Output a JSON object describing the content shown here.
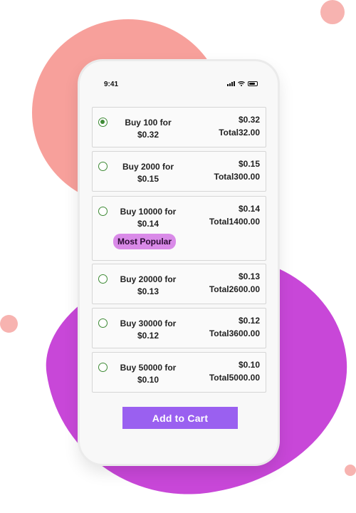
{
  "status_bar": {
    "time": "9:41"
  },
  "options": [
    {
      "line1": "Buy 100 for",
      "line2": "$0.32",
      "price": "$0.32",
      "total": "Total32.00",
      "selected": true
    },
    {
      "line1": "Buy 2000 for",
      "line2": "$0.15",
      "price": "$0.15",
      "total": "Total300.00",
      "selected": false
    },
    {
      "line1": "Buy 10000 for",
      "line2": "$0.14",
      "price": "$0.14",
      "total": "Total1400.00",
      "selected": false,
      "badge": "Most Popular"
    },
    {
      "line1": "Buy 20000 for",
      "line2": "$0.13",
      "price": "$0.13",
      "total": "Total2600.00",
      "selected": false
    },
    {
      "line1": "Buy 30000 for",
      "line2": "$0.12",
      "price": "$0.12",
      "total": "Total3600.00",
      "selected": false
    },
    {
      "line1": "Buy 50000 for",
      "line2": "$0.10",
      "price": "$0.10",
      "total": "Total5000.00",
      "selected": false
    }
  ],
  "cart_button": {
    "label": "Add to Cart"
  },
  "colors": {
    "accent": "#9a60f0",
    "radio": "#3e8a35",
    "badge": "#d98ae8",
    "blob_pink": "#f79b96",
    "blob_purple": "#c847d8"
  },
  "icons": [
    "signal-icon",
    "wifi-icon",
    "battery-icon",
    "radio-button-icon"
  ]
}
